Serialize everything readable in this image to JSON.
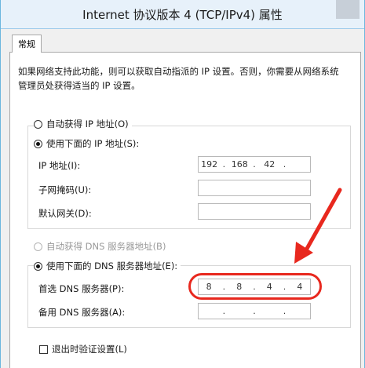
{
  "window": {
    "title": "Internet 协议版本 4 (TCP/IPv4) 属性"
  },
  "tabs": [
    {
      "label": "常规"
    }
  ],
  "description": "如果网络支持此功能，则可以获取自动指派的 IP 设置。否则，你需要从网络系统管理员处获得适当的 IP 设置。",
  "ip_section": {
    "auto_label": "自动获得 IP 地址(O)",
    "manual_label": "使用下面的 IP 地址(S):",
    "auto_selected": false,
    "manual_selected": true,
    "fields": [
      {
        "label": "IP 地址(I):",
        "parts": [
          "192",
          "168",
          "42",
          ""
        ]
      },
      {
        "label": "子网掩码(U):",
        "parts": [
          "",
          "",
          "",
          ""
        ]
      },
      {
        "label": "默认网关(D):",
        "parts": [
          "",
          "",
          "",
          ""
        ]
      }
    ]
  },
  "dns_section": {
    "auto_label": "自动获得 DNS 服务器地址(B)",
    "manual_label": "使用下面的 DNS 服务器地址(E):",
    "auto_selected": false,
    "auto_disabled": true,
    "manual_selected": true,
    "fields": [
      {
        "label": "首选 DNS 服务器(P):",
        "parts": [
          "8",
          "8",
          "4",
          "4"
        ]
      },
      {
        "label": "备用 DNS 服务器(A):",
        "parts": [
          "",
          "",
          "",
          ""
        ]
      }
    ]
  },
  "validate_on_exit": {
    "label": "退出时验证设置(L)",
    "checked": false
  },
  "annotation": {
    "color": "#e8281e"
  }
}
